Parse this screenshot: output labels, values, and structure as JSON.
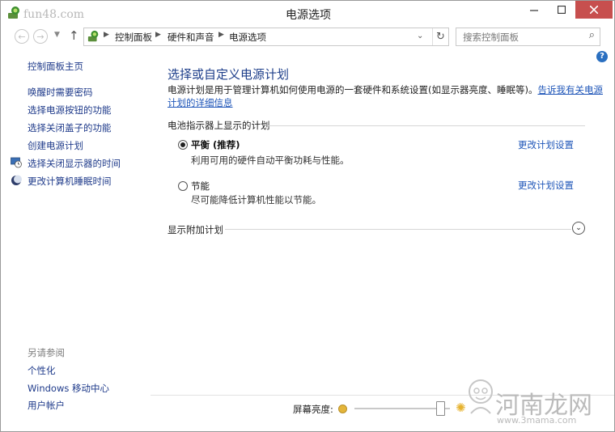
{
  "window": {
    "title": "电源选项",
    "watermark_top": "fun48.com"
  },
  "address": {
    "breadcrumbs": [
      "控制面板",
      "硬件和声音",
      "电源选项"
    ],
    "search_placeholder": "搜索控制面板"
  },
  "sidebar": {
    "home": "控制面板主页",
    "links": [
      {
        "label": "唤醒时需要密码",
        "icon": ""
      },
      {
        "label": "选择电源按钮的功能",
        "icon": ""
      },
      {
        "label": "选择关闭盖子的功能",
        "icon": ""
      },
      {
        "label": "创建电源计划",
        "icon": ""
      },
      {
        "label": "选择关闭显示器的时间",
        "icon": "monitor-clock-icon"
      },
      {
        "label": "更改计算机睡眠时间",
        "icon": "moon-icon"
      }
    ],
    "see_also_heading": "另请参阅",
    "see_also": [
      "个性化",
      "Windows 移动中心",
      "用户帐户"
    ]
  },
  "main": {
    "title": "选择或自定义电源计划",
    "description": "电源计划是用于管理计算机如何使用电源的一套硬件和系统设置(如显示器亮度、睡眠等)。",
    "description_link": "告诉我有关电源计划的详细信息",
    "group_label": "电池指示器上显示的计划",
    "plans": [
      {
        "name": "平衡 (推荐)",
        "desc": "利用可用的硬件自动平衡功耗与性能。",
        "link": "更改计划设置",
        "selected": true
      },
      {
        "name": "节能",
        "desc": "尽可能降低计算机性能以节能。",
        "link": "更改计划设置",
        "selected": false
      }
    ],
    "extra_label": "显示附加计划"
  },
  "brightness": {
    "label": "屏幕亮度:",
    "level": 0.9
  },
  "logo": {
    "text_cn": "河南龙网",
    "url": "www.3mama.com"
  }
}
